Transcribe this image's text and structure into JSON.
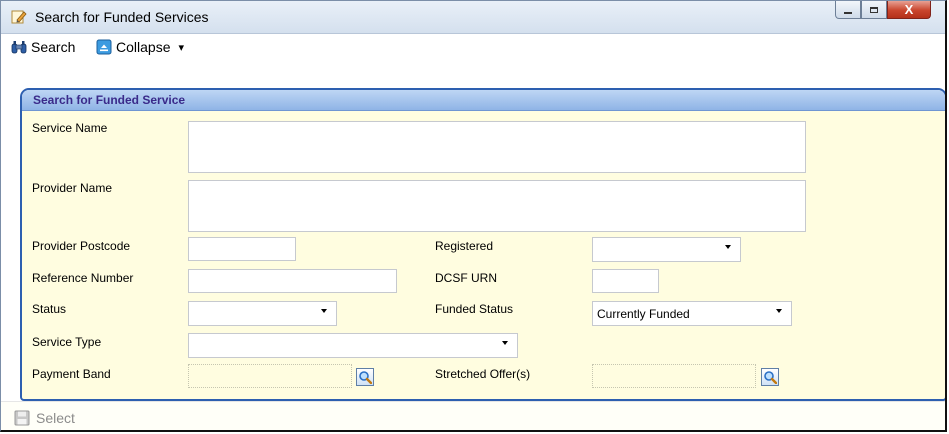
{
  "window": {
    "title": "Search for Funded Services",
    "close_label": "X"
  },
  "toolbar": {
    "search_label": "Search",
    "collapse_label": "Collapse",
    "dropdown_glyph": "▾"
  },
  "panel": {
    "title": "Search for Funded Service"
  },
  "form": {
    "service_name_label": "Service Name",
    "service_name_value": "",
    "provider_name_label": "Provider Name",
    "provider_name_value": "",
    "provider_postcode_label": "Provider Postcode",
    "provider_postcode_value": "",
    "reference_number_label": "Reference Number",
    "reference_number_value": "",
    "status_label": "Status",
    "status_value": "",
    "service_type_label": "Service Type",
    "service_type_value": "",
    "payment_band_label": "Payment Band",
    "payment_band_value": "",
    "registered_label": "Registered",
    "registered_value": "",
    "dcsf_urn_label": "DCSF URN",
    "dcsf_urn_value": "",
    "funded_status_label": "Funded Status",
    "funded_status_value": "Currently Funded",
    "stretched_offers_label": "Stretched Offer(s)",
    "stretched_offers_value": ""
  },
  "footer": {
    "select_label": "Select"
  },
  "icons": {
    "title": "pencil-note-icon",
    "search": "binoculars-icon",
    "collapse": "collapse-icon",
    "lookup": "magnifier-icon",
    "select": "save-disk-icon"
  },
  "colors": {
    "panel_background": "#fffde0",
    "panel_border": "#2d5fb0",
    "panel_header_text": "#3a2a8a",
    "close_button": "#c9452d"
  }
}
